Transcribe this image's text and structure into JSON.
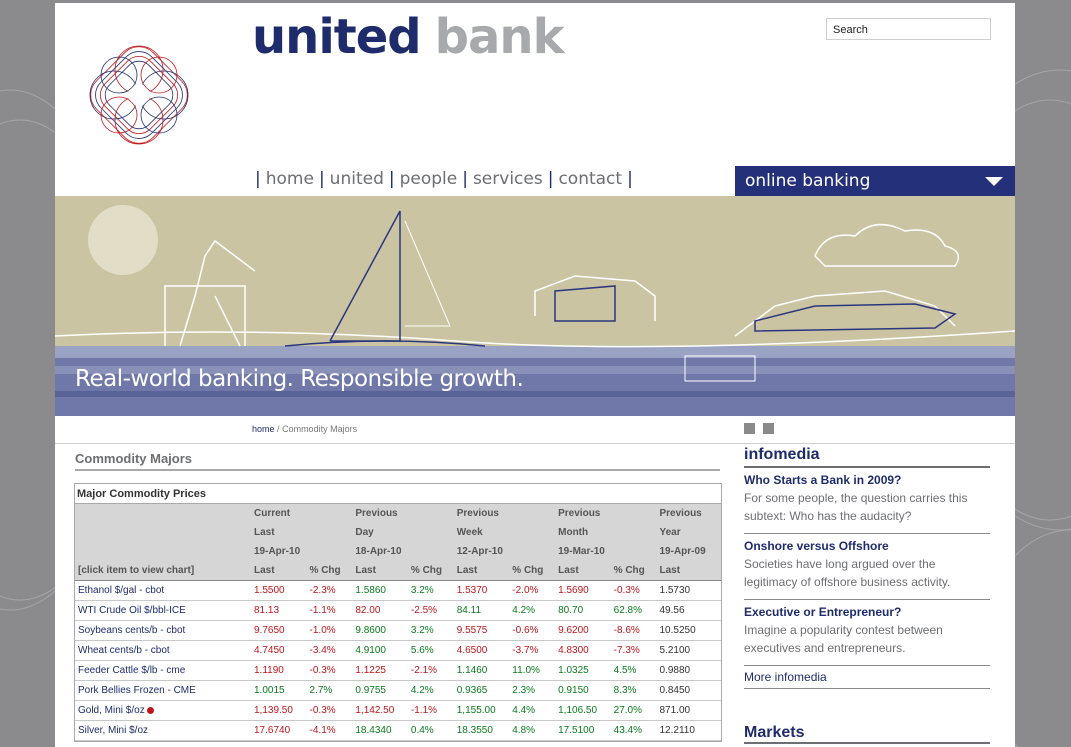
{
  "brand": {
    "part1": "united",
    "part2": "bank"
  },
  "search": {
    "value": "Search"
  },
  "nav": {
    "items": [
      "home",
      "united",
      "people",
      "services",
      "contact"
    ]
  },
  "online_banking": {
    "label": "online banking"
  },
  "banner": {
    "tagline": "Real-world banking. Responsible growth."
  },
  "breadcrumb": {
    "home": "home",
    "sep": "/",
    "current": "Commodity Majors"
  },
  "icons": {
    "rss": "rss-icon",
    "print": "print-icon"
  },
  "main": {
    "title": "Commodity Majors",
    "table_caption": "Major Commodity Prices",
    "header": {
      "row1": [
        "Current",
        "Previous",
        "Previous",
        "Previous",
        "Previous"
      ],
      "row2": [
        "Last",
        "Day",
        "Week",
        "Month",
        "Year"
      ],
      "row3": [
        "19-Apr-10",
        "18-Apr-10",
        "12-Apr-10",
        "19-Mar-10",
        "19-Apr-09"
      ],
      "click_hint": "[click item to view chart]",
      "last": "Last",
      "chg": "% Chg"
    },
    "rows": [
      {
        "name": "Ethanol $/gal - cbot",
        "cur": "1.5500",
        "c1": "-2.3%",
        "day": "1.5860",
        "c2": "3.2%",
        "week": "1.5370",
        "c3": "-2.0%",
        "month": "1.5690",
        "c4": "-0.3%",
        "year": "1.5730"
      },
      {
        "name": "WTI Crude Oil $/bbl-ICE",
        "cur": "81.13",
        "c1": "-1.1%",
        "day": "82.00",
        "c2": "-2.5%",
        "week": "84.11",
        "c3": "4.2%",
        "month": "80.70",
        "c4": "62.8%",
        "year": "49.56"
      },
      {
        "name": "Soybeans cents/b - cbot",
        "cur": "9.7650",
        "c1": "-1.0%",
        "day": "9.8600",
        "c2": "3.2%",
        "week": "9.5575",
        "c3": "-0.6%",
        "month": "9.6200",
        "c4": "-8.6%",
        "year": "10.5250"
      },
      {
        "name": "Wheat cents/b - cbot",
        "cur": "4.7450",
        "c1": "-3.4%",
        "day": "4.9100",
        "c2": "5.6%",
        "week": "4.6500",
        "c3": "-3.7%",
        "month": "4.8300",
        "c4": "-7.3%",
        "year": "5.2100"
      },
      {
        "name": "Feeder Cattle $/lb - cme",
        "cur": "1.1190",
        "c1": "-0.3%",
        "day": "1.1225",
        "c2": "-2.1%",
        "week": "1.1460",
        "c3": "11.0%",
        "month": "1.0325",
        "c4": "4.5%",
        "year": "0.9880"
      },
      {
        "name": "Pork Bellies Frozen - CME",
        "cur": "1.0015",
        "c1": "2.7%",
        "day": "0.9755",
        "c2": "4.2%",
        "week": "0.9365",
        "c3": "2.3%",
        "month": "0.9150",
        "c4": "8.3%",
        "year": "0.8450"
      },
      {
        "name": "Gold, Mini $/oz",
        "cur": "1,139.50",
        "c1": "-0.3%",
        "day": "1,142.50",
        "c2": "-1.1%",
        "week": "1,155.00",
        "c3": "4.4%",
        "month": "1,106.50",
        "c4": "27.0%",
        "year": "871.00"
      },
      {
        "name": "Silver, Mini $/oz",
        "cur": "17.6740",
        "c1": "-4.1%",
        "day": "18.4340",
        "c2": "0.4%",
        "week": "18.3550",
        "c3": "4.8%",
        "month": "17.5100",
        "c4": "43.4%",
        "year": "12.2110"
      }
    ]
  },
  "sidebar": {
    "title": "infomedia",
    "items": [
      {
        "title": "Who Starts a Bank in 2009?",
        "desc": "For some people, the question carries this subtext: Who has the audacity?"
      },
      {
        "title": "Onshore versus Offshore",
        "desc": "Societies have long argued over the legitimacy of offshore business activity."
      },
      {
        "title": "Executive or Entrepreneur?",
        "desc": "Imagine a popularity contest between executives and entrepreneurs."
      }
    ],
    "more": "More infomedia",
    "markets": "Markets"
  },
  "colors": {
    "navy": "#1f2c6b",
    "grey": "#a7a9ac",
    "up": "#0a7a1c",
    "down": "#c0151b"
  }
}
